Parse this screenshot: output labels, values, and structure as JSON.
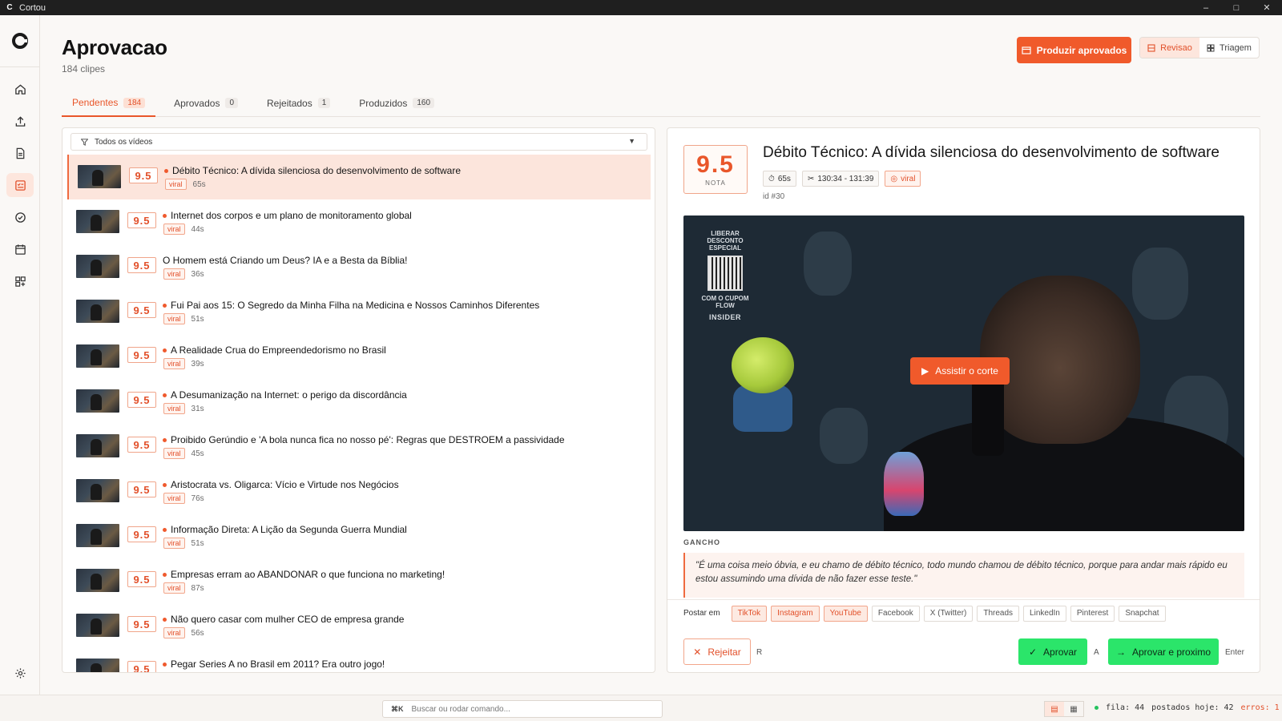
{
  "window": {
    "title": "Cortou",
    "app_initial": "C"
  },
  "header": {
    "title": "Aprovacao",
    "subtitle": "184 clipes",
    "produce_label": "Produzir aprovados",
    "modes": [
      {
        "label": "Revisao",
        "active": true
      },
      {
        "label": "Triagem",
        "active": false
      }
    ]
  },
  "tabs": [
    {
      "label": "Pendentes",
      "count": "184",
      "active": true
    },
    {
      "label": "Aprovados",
      "count": "0",
      "active": false
    },
    {
      "label": "Rejeitados",
      "count": "1",
      "active": false
    },
    {
      "label": "Produzidos",
      "count": "160",
      "active": false
    }
  ],
  "filter": {
    "label": "Todos os vídeos"
  },
  "clips": [
    {
      "score": "9.5",
      "title": "Débito Técnico: A dívida silenciosa do desenvolvimento de software",
      "tag": "viral",
      "duration": "65s",
      "dot": true,
      "selected": true
    },
    {
      "score": "9.5",
      "title": "Internet dos corpos e um plano de monitoramento global",
      "tag": "viral",
      "duration": "44s",
      "dot": true
    },
    {
      "score": "9.5",
      "title": "O Homem está Criando um Deus? IA e a Besta da Bíblia!",
      "tag": "viral",
      "duration": "36s",
      "dot": false
    },
    {
      "score": "9.5",
      "title": "Fui Pai aos 15: O Segredo da Minha Filha na Medicina e Nossos Caminhos Diferentes",
      "tag": "viral",
      "duration": "51s",
      "dot": true
    },
    {
      "score": "9.5",
      "title": "A Realidade Crua do Empreendedorismo no Brasil",
      "tag": "viral",
      "duration": "39s",
      "dot": true
    },
    {
      "score": "9.5",
      "title": "A Desumanização na Internet: o perigo da discordância",
      "tag": "viral",
      "duration": "31s",
      "dot": true
    },
    {
      "score": "9.5",
      "title": "Proibido Gerúndio e 'A bola nunca fica no nosso pé': Regras que DESTROEM a passividade",
      "tag": "viral",
      "duration": "45s",
      "dot": true
    },
    {
      "score": "9.5",
      "title": "Aristocrata vs. Oligarca: Vício e Virtude nos Negócios",
      "tag": "viral",
      "duration": "76s",
      "dot": true
    },
    {
      "score": "9.5",
      "title": "Informação Direta: A Lição da Segunda Guerra Mundial",
      "tag": "viral",
      "duration": "51s",
      "dot": true
    },
    {
      "score": "9.5",
      "title": "Empresas erram ao ABANDONAR o que funciona no marketing!",
      "tag": "viral",
      "duration": "87s",
      "dot": true
    },
    {
      "score": "9.5",
      "title": "Não quero casar com mulher CEO de empresa grande",
      "tag": "viral",
      "duration": "56s",
      "dot": true
    },
    {
      "score": "9.5",
      "title": "Pegar Series A no Brasil em 2011? Era outro jogo!",
      "tag": "viral",
      "duration": "",
      "dot": true
    }
  ],
  "detail": {
    "score": "9.5",
    "score_label": "NOTA",
    "title": "Débito Técnico: A dívida silenciosa do desenvolvimento de software",
    "duration": "65s",
    "range": "130:34 - 131:39",
    "tag": "viral",
    "id": "id #30",
    "video": {
      "promo_top": "LIBERAR DESCONTO ESPECIAL",
      "promo_coupon": "COM O CUPOM FLOW",
      "promo_brand": "INSIDER",
      "play_label": "Assistir o corte"
    },
    "gancho_label": "GANCHO",
    "gancho_text": "\"É uma coisa meio óbvia, e eu chamo de débito técnico, todo mundo chamou de débito técnico, porque para andar mais rápido eu estou assumindo uma dívida de não fazer esse teste.\"",
    "post_label": "Postar em",
    "platforms": [
      {
        "label": "TikTok",
        "on": true
      },
      {
        "label": "Instagram",
        "on": true
      },
      {
        "label": "YouTube",
        "on": true
      },
      {
        "label": "Facebook",
        "on": false
      },
      {
        "label": "X (Twitter)",
        "on": false
      },
      {
        "label": "Threads",
        "on": false
      },
      {
        "label": "LinkedIn",
        "on": false
      },
      {
        "label": "Pinterest",
        "on": false
      },
      {
        "label": "Snapchat",
        "on": false
      }
    ],
    "reject_label": "Rejeitar",
    "reject_key": "R",
    "approve_label": "Aprovar",
    "approve_key": "A",
    "approve_next_label": "Aprovar e proximo",
    "approve_next_key": "Enter"
  },
  "bottom": {
    "command_key": "⌘K",
    "command_placeholder": "Buscar ou rodar comando...",
    "queue": "fila: 44",
    "posted_today": "postados hoje: 42",
    "errors": "erros: 1"
  },
  "colors": {
    "accent": "#f05a2b",
    "approve": "#2be56a",
    "selected_row": "#fce5dc"
  }
}
